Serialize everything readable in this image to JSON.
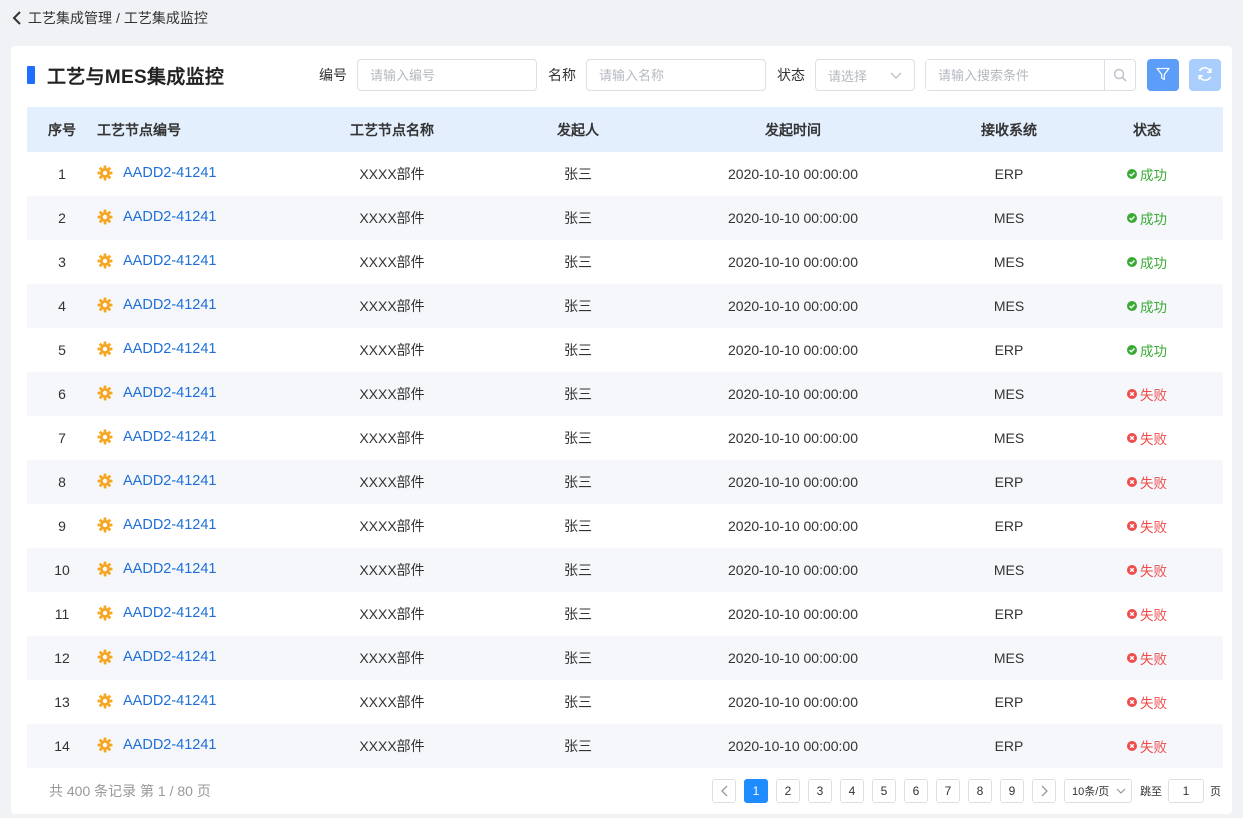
{
  "breadcrumb": {
    "parent": "工艺集成管理",
    "separator": "/",
    "current": "工艺集成监控"
  },
  "title": "工艺与MES集成监控",
  "filters": {
    "code_label": "编号",
    "code_placeholder": "请输入编号",
    "name_label": "名称",
    "name_placeholder": "请输入名称",
    "status_label": "状态",
    "status_placeholder": "请选择",
    "search_placeholder": "请输入搜索条件"
  },
  "columns": [
    "序号",
    "工艺节点编号",
    "工艺节点名称",
    "发起人",
    "发起时间",
    "接收系统",
    "状态"
  ],
  "rows": [
    {
      "no": "1",
      "code": "AADD2-41241",
      "name": "XXXX部件",
      "initiator": "张三",
      "time": "2020-10-10 00:00:00",
      "system": "ERP",
      "status": "成功",
      "ok": true
    },
    {
      "no": "2",
      "code": "AADD2-41241",
      "name": "XXXX部件",
      "initiator": "张三",
      "time": "2020-10-10 00:00:00",
      "system": "MES",
      "status": "成功",
      "ok": true
    },
    {
      "no": "3",
      "code": "AADD2-41241",
      "name": "XXXX部件",
      "initiator": "张三",
      "time": "2020-10-10 00:00:00",
      "system": "MES",
      "status": "成功",
      "ok": true
    },
    {
      "no": "4",
      "code": "AADD2-41241",
      "name": "XXXX部件",
      "initiator": "张三",
      "time": "2020-10-10 00:00:00",
      "system": "MES",
      "status": "成功",
      "ok": true
    },
    {
      "no": "5",
      "code": "AADD2-41241",
      "name": "XXXX部件",
      "initiator": "张三",
      "time": "2020-10-10 00:00:00",
      "system": "ERP",
      "status": "成功",
      "ok": true
    },
    {
      "no": "6",
      "code": "AADD2-41241",
      "name": "XXXX部件",
      "initiator": "张三",
      "time": "2020-10-10 00:00:00",
      "system": "MES",
      "status": "失败",
      "ok": false
    },
    {
      "no": "7",
      "code": "AADD2-41241",
      "name": "XXXX部件",
      "initiator": "张三",
      "time": "2020-10-10 00:00:00",
      "system": "MES",
      "status": "失败",
      "ok": false
    },
    {
      "no": "8",
      "code": "AADD2-41241",
      "name": "XXXX部件",
      "initiator": "张三",
      "time": "2020-10-10 00:00:00",
      "system": "ERP",
      "status": "失败",
      "ok": false
    },
    {
      "no": "9",
      "code": "AADD2-41241",
      "name": "XXXX部件",
      "initiator": "张三",
      "time": "2020-10-10 00:00:00",
      "system": "ERP",
      "status": "失败",
      "ok": false
    },
    {
      "no": "10",
      "code": "AADD2-41241",
      "name": "XXXX部件",
      "initiator": "张三",
      "time": "2020-10-10 00:00:00",
      "system": "MES",
      "status": "失败",
      "ok": false
    },
    {
      "no": "11",
      "code": "AADD2-41241",
      "name": "XXXX部件",
      "initiator": "张三",
      "time": "2020-10-10 00:00:00",
      "system": "ERP",
      "status": "失败",
      "ok": false
    },
    {
      "no": "12",
      "code": "AADD2-41241",
      "name": "XXXX部件",
      "initiator": "张三",
      "time": "2020-10-10 00:00:00",
      "system": "MES",
      "status": "失败",
      "ok": false
    },
    {
      "no": "13",
      "code": "AADD2-41241",
      "name": "XXXX部件",
      "initiator": "张三",
      "time": "2020-10-10 00:00:00",
      "system": "ERP",
      "status": "失败",
      "ok": false
    },
    {
      "no": "14",
      "code": "AADD2-41241",
      "name": "XXXX部件",
      "initiator": "张三",
      "time": "2020-10-10 00:00:00",
      "system": "ERP",
      "status": "失败",
      "ok": false
    }
  ],
  "footer": {
    "total_text": "共 400 条记录 第 1 / 80 页",
    "pages": [
      "1",
      "2",
      "3",
      "4",
      "5",
      "6",
      "7",
      "8",
      "9"
    ],
    "active_page": "1",
    "page_size": "10条/页",
    "jump_label": "跳至",
    "jump_value": "1",
    "page_unit": "页"
  },
  "colors": {
    "accent": "#1e6fff",
    "link": "#1e6fd9",
    "success": "#3aaa35",
    "fail": "#ef4c4c",
    "gear": "#f5a623",
    "header_bg": "#e3effd"
  },
  "icons": {
    "back": "chevron-left-icon",
    "filter": "funnel-icon",
    "refresh": "refresh-icon",
    "search": "search-icon",
    "gear": "gear-icon",
    "success": "check-circle-icon",
    "fail": "x-circle-icon"
  }
}
